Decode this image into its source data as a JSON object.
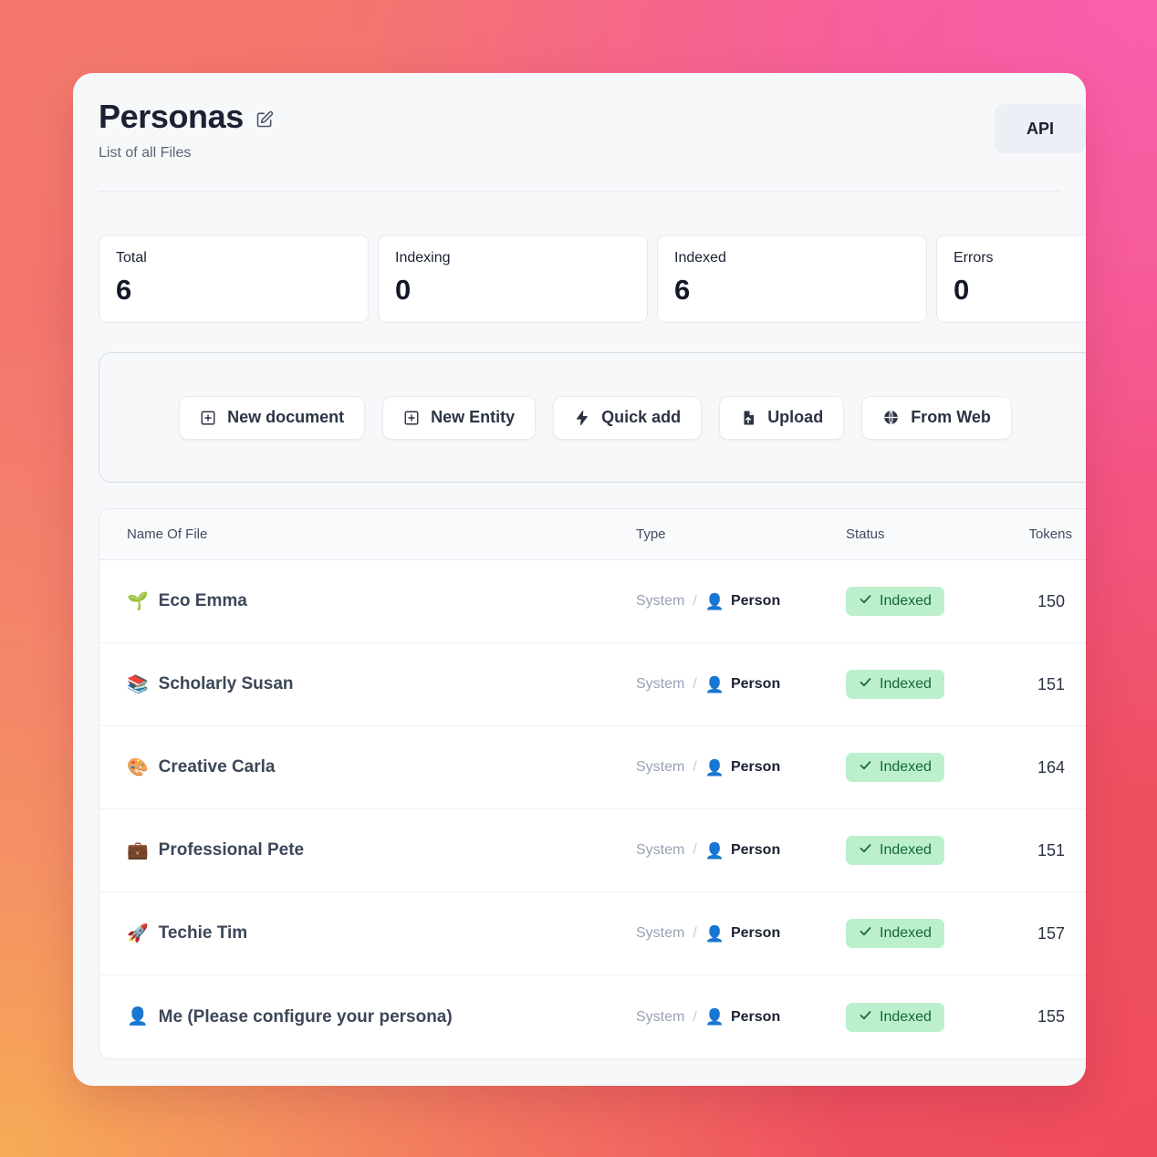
{
  "header": {
    "title": "Personas",
    "subtitle": "List of all Files",
    "edit_icon": "edit-pencil-square-icon",
    "api_label": "API"
  },
  "stats": [
    {
      "label": "Total",
      "value": "6"
    },
    {
      "label": "Indexing",
      "value": "0"
    },
    {
      "label": "Indexed",
      "value": "6"
    },
    {
      "label": "Errors",
      "value": "0"
    }
  ],
  "actions": [
    {
      "label": "New document",
      "icon": "plus-square-icon"
    },
    {
      "label": "New Entity",
      "icon": "plus-square-icon"
    },
    {
      "label": "Quick add",
      "icon": "lightning-bolt-icon"
    },
    {
      "label": "Upload",
      "icon": "file-upload-icon"
    },
    {
      "label": "From Web",
      "icon": "globe-icon"
    }
  ],
  "table": {
    "columns": {
      "name": "Name Of File",
      "type": "Type",
      "status": "Status",
      "tokens": "Tokens"
    },
    "rows": [
      {
        "emoji": "🌱",
        "name": "Eco Emma",
        "type_system": "System",
        "type_sep": "/",
        "type_person_emoji": "👤",
        "type_person": "Person",
        "status": "Indexed",
        "tokens": "150"
      },
      {
        "emoji": "📚",
        "name": "Scholarly Susan",
        "type_system": "System",
        "type_sep": "/",
        "type_person_emoji": "👤",
        "type_person": "Person",
        "status": "Indexed",
        "tokens": "151"
      },
      {
        "emoji": "🎨",
        "name": "Creative Carla",
        "type_system": "System",
        "type_sep": "/",
        "type_person_emoji": "👤",
        "type_person": "Person",
        "status": "Indexed",
        "tokens": "164"
      },
      {
        "emoji": "💼",
        "name": "Professional Pete",
        "type_system": "System",
        "type_sep": "/",
        "type_person_emoji": "👤",
        "type_person": "Person",
        "status": "Indexed",
        "tokens": "151"
      },
      {
        "emoji": "🚀",
        "name": "Techie Tim",
        "type_system": "System",
        "type_sep": "/",
        "type_person_emoji": "👤",
        "type_person": "Person",
        "status": "Indexed",
        "tokens": "157"
      },
      {
        "emoji": "👤",
        "name": "Me (Please configure your persona)",
        "type_system": "System",
        "type_sep": "/",
        "type_person_emoji": "👤",
        "type_person": "Person",
        "status": "Indexed",
        "tokens": "155"
      }
    ]
  },
  "colors": {
    "badge_bg": "#bcf0cd",
    "badge_text": "#14663a",
    "card_bg": "#f7f8fa",
    "page_gradient_start": "#f4796c",
    "page_gradient_pink": "#fa5fae",
    "page_gradient_orange": "#f7ab56",
    "page_gradient_red": "#ef4a5e"
  }
}
